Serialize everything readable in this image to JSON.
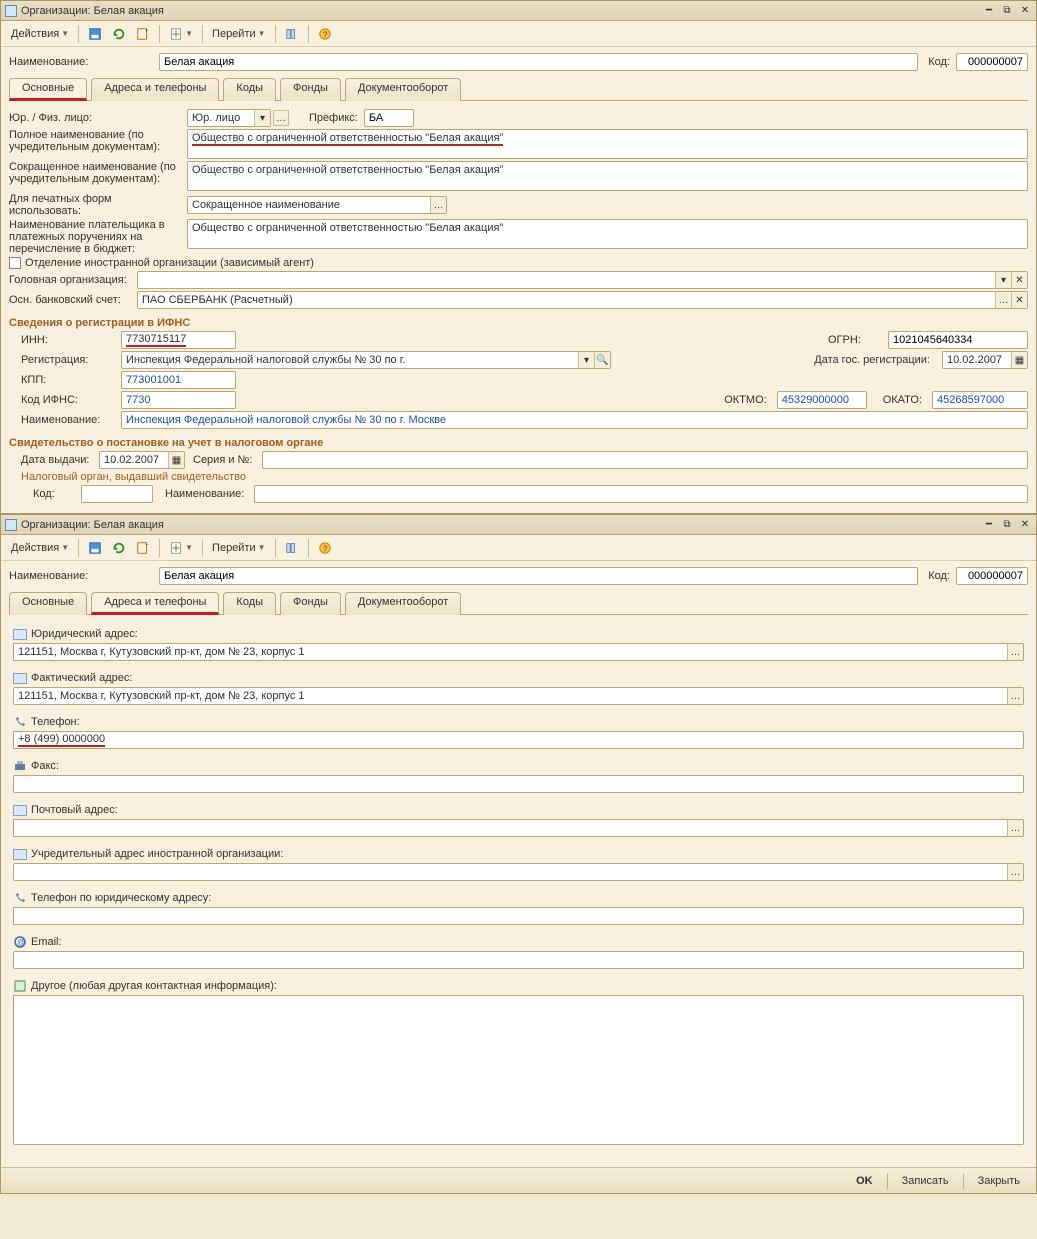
{
  "window_title": "Организации: Белая акация",
  "toolbar": {
    "actions": "Действия",
    "go": "Перейти"
  },
  "header": {
    "name_label": "Наименование:",
    "name_value": "Белая акация",
    "code_label": "Код:",
    "code_value": "000000007"
  },
  "tabs": {
    "main": "Основные",
    "addresses": "Адреса и телефоны",
    "codes": "Коды",
    "funds": "Фонды",
    "docflow": "Документооборот"
  },
  "main": {
    "legal_type_label": "Юр. / Физ. лицо:",
    "legal_type_value": "Юр. лицо",
    "prefix_label": "Префикс:",
    "prefix_value": "БА",
    "full_name_label": "Полное наименование (по учредительным документам):",
    "full_name_value": "Общество с ограниченной ответственностью \"Белая акация\"",
    "short_name_label": "Сокращенное наименование (по учредительным документам):",
    "short_name_value": "Общество с ограниченной ответственностью \"Белая акация\"",
    "print_forms_label": "Для печатных форм использовать:",
    "print_forms_value": "Сокращенное наименование",
    "payer_name_label": "Наименование плательщика в платежных поручениях на перечисление в бюджет:",
    "payer_name_value": "Общество с ограниченной ответственностью \"Белая акация\"",
    "foreign_branch_label": "Отделение иностранной организации (зависимый агент)",
    "head_org_label": "Головная организация:",
    "head_org_value": "",
    "bank_label": "Осн. банковский счет:",
    "bank_value": "ПАО СБЕРБАНК (Расчетный)",
    "ifns_section": "Сведения о регистрации в ИФНС",
    "inn_label": "ИНН:",
    "inn_value": "7730715117",
    "ogrn_label": "ОГРН:",
    "ogrn_value": "1021045640334",
    "registration_label": "Регистрация:",
    "registration_value": "Инспекция Федеральной налоговой службы № 30 по г.",
    "reg_date_label": "Дата гос. регистрации:",
    "reg_date_value": "10.02.2007",
    "kpp_label": "КПП:",
    "kpp_value": "773001001",
    "ifns_code_label": "Код ИФНС:",
    "ifns_code_value": "7730",
    "oktmo_label": "ОКТМО:",
    "oktmo_value": "45329000000",
    "okato_label": "ОКАТО:",
    "okato_value": "45268597000",
    "ifns_name_label": "Наименование:",
    "ifns_name_value": "Инспекция Федеральной налоговой службы № 30 по г. Москве",
    "cert_section": "Свидетельство о постановке на учет в налоговом органе",
    "issue_date_label": "Дата выдачи:",
    "issue_date_value": "10.02.2007",
    "serial_label": "Серия и №:",
    "serial_value": "",
    "tax_authority_note": "Налоговый орган, выдавший свидетельство",
    "tax_code_label": "Код:",
    "tax_code_value": "",
    "tax_name_label": "Наименование:",
    "tax_name_value": ""
  },
  "addresses": {
    "legal_label": "Юридический адрес:",
    "legal_value": "121151, Москва г, Кутузовский пр-кт, дом № 23, корпус 1",
    "actual_label": "Фактический адрес:",
    "actual_value": "121151, Москва г, Кутузовский пр-кт, дом № 23, корпус 1",
    "phone_label": "Телефон:",
    "phone_value": "+8 (499) 0000000",
    "fax_label": "Факс:",
    "fax_value": "",
    "postal_label": "Почтовый адрес:",
    "postal_value": "",
    "founding_label": "Учредительный адрес иностранной организации:",
    "founding_value": "",
    "phone_legal_label": "Телефон по юридическому адресу:",
    "phone_legal_value": "",
    "email_label": "Email:",
    "email_value": "",
    "other_label": "Другое (любая другая контактная информация):",
    "other_value": ""
  },
  "footer": {
    "ok": "OK",
    "save": "Записать",
    "close": "Закрыть"
  }
}
